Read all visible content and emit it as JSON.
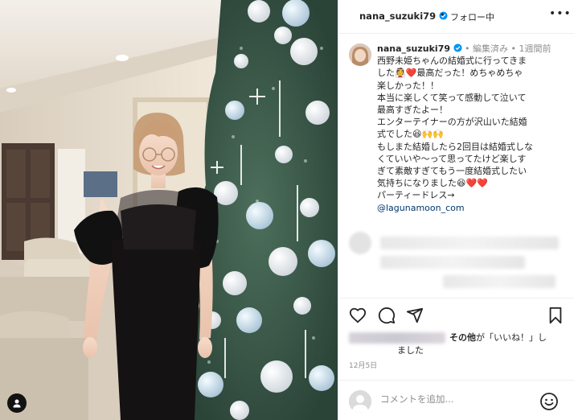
{
  "header": {
    "username": "nana_suzuki79",
    "separator": "•",
    "follow_label": "フォロー中",
    "more_label": "•••"
  },
  "caption": {
    "username": "nana_suzuki79",
    "edited": "• 編集済み •",
    "time_ago": "1週間前",
    "lines": [
      "西野未姫ちゃんの結婚式に行ってきま",
      "した👰❤️最高だった！めちゃめちゃ",
      "楽しかった！！",
      "本当に楽しくて笑って感動して泣いて",
      "最高すぎたよー！",
      "エンターテイナーの方が沢山いた結婚",
      "式でした😆🙌🙌",
      "もしまた結婚したら2回目は結婚式しな",
      "くていいや〜って思ってたけど楽しす",
      "ぎて素敵すぎてもう一度結婚式したい",
      "気持ちになりました😆❤️❤️",
      "パーティードレス→"
    ],
    "mention": "@lagunamoon_com"
  },
  "likes": {
    "suffix_bold": "その他",
    "suffix_text": "が「いいね！」し",
    "line2": "ました"
  },
  "date": "12月5日",
  "comment": {
    "placeholder": "コメントを追加..."
  },
  "colors": {
    "verified": "#0095f6",
    "mention": "#00376b",
    "secondary_text": "#8e8e8e",
    "border": "#efefef"
  },
  "icons": {
    "user_tag": "person-icon",
    "like": "heart-icon",
    "comment": "comment-icon",
    "share": "paper-plane-icon",
    "save": "bookmark-icon",
    "emoji": "smiley-icon",
    "more": "ellipsis-icon",
    "verified": "verified-badge-icon"
  }
}
